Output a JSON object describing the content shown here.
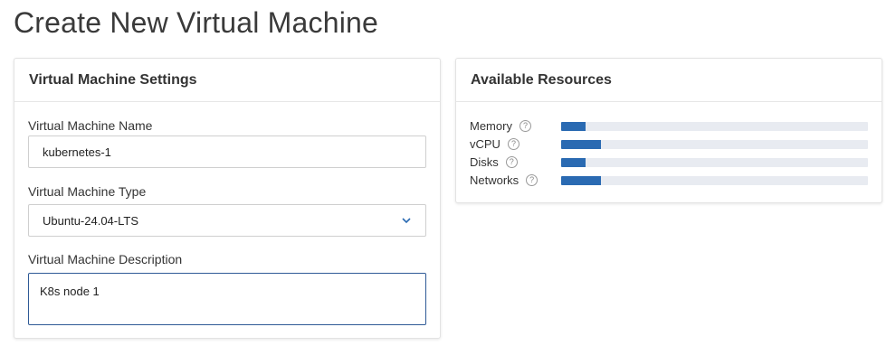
{
  "page": {
    "title": "Create New Virtual Machine"
  },
  "settings_panel": {
    "title": "Virtual Machine Settings",
    "name_label": "Virtual Machine Name",
    "name_value": "kubernetes-1",
    "type_label": "Virtual Machine Type",
    "type_value": "Ubuntu-24.04-LTS",
    "description_label": "Virtual Machine Description",
    "description_value": "K8s node 1"
  },
  "resources_panel": {
    "title": "Available Resources",
    "items": [
      {
        "label": "Memory",
        "help_icon": "question-circle-icon",
        "fill_fraction": 0.08
      },
      {
        "label": "vCPU",
        "help_icon": "question-circle-icon",
        "fill_fraction": 0.13
      },
      {
        "label": "Disks",
        "help_icon": "question-circle-icon",
        "fill_fraction": 0.08
      },
      {
        "label": "Networks",
        "help_icon": "question-circle-icon",
        "fill_fraction": 0.13
      }
    ],
    "bar_color": "#2a6ab2",
    "track_color": "#e8ebf1"
  }
}
